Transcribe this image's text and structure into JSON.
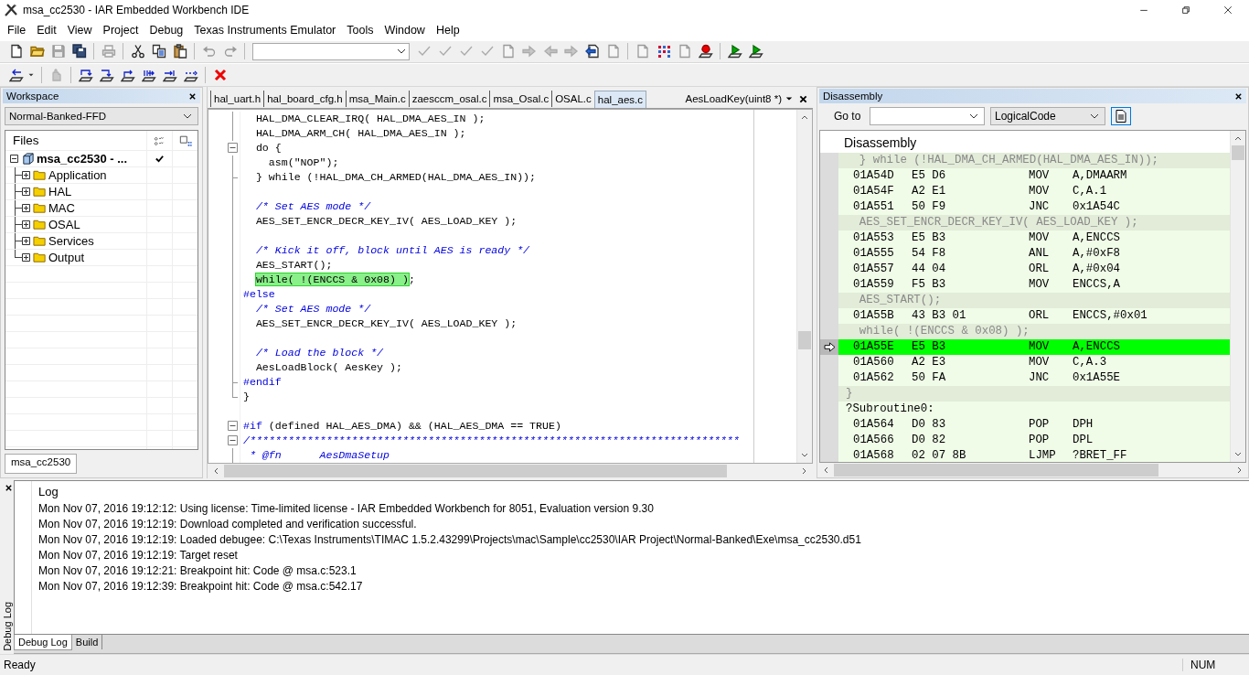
{
  "window": {
    "title": "msa_cc2530 - IAR Embedded Workbench IDE"
  },
  "menu": [
    "File",
    "Edit",
    "View",
    "Project",
    "Debug",
    "Texas Instruments Emulator",
    "Tools",
    "Window",
    "Help"
  ],
  "toolbar_1": [
    {
      "kind": "page",
      "disabled": false
    },
    {
      "kind": "folder",
      "disabled": false
    },
    {
      "kind": "floppy",
      "disabled": true
    },
    {
      "kind": "floppies",
      "disabled": false
    },
    {
      "kind": "separator"
    },
    {
      "kind": "printer",
      "disabled": true
    },
    {
      "kind": "separator"
    },
    {
      "kind": "scissors",
      "disabled": false
    },
    {
      "kind": "copy",
      "disabled": false
    },
    {
      "kind": "clipboard",
      "disabled": false
    },
    {
      "kind": "separator"
    },
    {
      "kind": "undo",
      "disabled": true
    },
    {
      "kind": "redo",
      "disabled": true
    },
    {
      "kind": "separator"
    },
    {
      "kind": "combo"
    },
    {
      "kind": "check",
      "disabled": true
    },
    {
      "kind": "check",
      "disabled": true
    },
    {
      "kind": "check",
      "disabled": true
    },
    {
      "kind": "check",
      "disabled": true
    },
    {
      "kind": "page",
      "disabled": true
    },
    {
      "kind": "arrow-right",
      "disabled": true
    },
    {
      "kind": "arrow-left",
      "disabled": true
    },
    {
      "kind": "arrow-right",
      "disabled": true
    },
    {
      "kind": "nav",
      "disabled": false
    },
    {
      "kind": "page",
      "disabled": true
    },
    {
      "kind": "separator"
    },
    {
      "kind": "page",
      "disabled": true
    },
    {
      "kind": "dots",
      "disabled": false
    },
    {
      "kind": "page",
      "disabled": true
    },
    {
      "kind": "dot",
      "disabled": false
    },
    {
      "kind": "separator"
    },
    {
      "kind": "play",
      "disabled": false
    },
    {
      "kind": "play",
      "disabled": false
    }
  ],
  "toolbar_2": [
    {
      "kind": "reset",
      "disabled": false
    },
    {
      "kind": "caret",
      "disabled": false
    },
    {
      "kind": "separator"
    },
    {
      "kind": "hand",
      "disabled": true
    },
    {
      "kind": "separator"
    },
    {
      "kind": "step-over",
      "disabled": false
    },
    {
      "kind": "step-into",
      "disabled": false
    },
    {
      "kind": "step-out",
      "disabled": false
    },
    {
      "kind": "next",
      "disabled": false
    },
    {
      "kind": "run-cursor",
      "disabled": false
    },
    {
      "kind": "go",
      "disabled": false
    },
    {
      "kind": "separator"
    },
    {
      "kind": "x",
      "disabled": false
    }
  ],
  "workspace": {
    "title": "Workspace",
    "configuration": "Normal-Banked-FFD",
    "files_header": "Files",
    "tree": {
      "label": "msa_cc2530 - ...",
      "expanded": true,
      "checked": true,
      "children": [
        {
          "label": "Application",
          "expanded": false
        },
        {
          "label": "HAL",
          "expanded": false
        },
        {
          "label": "MAC",
          "expanded": false
        },
        {
          "label": "OSAL",
          "expanded": false
        },
        {
          "label": "Services",
          "expanded": false
        },
        {
          "label": "Output",
          "expanded": false
        }
      ]
    },
    "tab": "msa_cc2530"
  },
  "editor": {
    "tabs": [
      {
        "label": "hal_uart.h",
        "selected": false
      },
      {
        "label": "hal_board_cfg.h",
        "selected": false
      },
      {
        "label": "msa_Main.c",
        "selected": false
      },
      {
        "label": "zaesccm_osal.c",
        "selected": false
      },
      {
        "label": "msa_Osal.c",
        "selected": false
      },
      {
        "label": "OSAL.c",
        "selected": false
      },
      {
        "label": "hal_aes.c",
        "selected": true
      }
    ],
    "function": "AesLoadKey(uint8 *)",
    "lines": [
      {
        "kind": "line",
        "segments": [
          {
            "kind": "code",
            "text": "  HAL_DMA_CLEAR_IRQ( HAL_DMA_AES_IN );"
          }
        ]
      },
      {
        "kind": "line",
        "segments": [
          {
            "kind": "code",
            "text": "  HAL_DMA_ARM_CH( HAL_DMA_AES_IN );"
          }
        ]
      },
      {
        "kind": "box",
        "segments": [
          {
            "kind": "code",
            "text": "  do {"
          }
        ]
      },
      {
        "kind": "line",
        "segments": [
          {
            "kind": "code",
            "text": "    asm(\"NOP\");"
          }
        ]
      },
      {
        "kind": "end",
        "segments": [
          {
            "kind": "code",
            "text": "  } while (!HAL_DMA_CH_ARMED(HAL_DMA_AES_IN));"
          }
        ]
      },
      {
        "kind": "line"
      },
      {
        "kind": "line",
        "segments": [
          {
            "kind": "comment",
            "text": "  /* Set AES mode */"
          }
        ]
      },
      {
        "kind": "line",
        "segments": [
          {
            "kind": "code",
            "text": "  AES_SET_ENCR_DECR_KEY_IV( AES_LOAD_KEY );"
          }
        ]
      },
      {
        "kind": "line"
      },
      {
        "kind": "line",
        "segments": [
          {
            "kind": "comment",
            "text": "  /* Kick it off, block until AES is ready */"
          }
        ]
      },
      {
        "kind": "line",
        "segments": [
          {
            "kind": "code",
            "text": "  AES_START();"
          }
        ]
      },
      {
        "kind": "line",
        "segments": [
          {
            "kind": "current",
            "text": "while( !(ENCCS & 0x08) )"
          },
          {
            "kind": "code",
            "text": ";"
          }
        ]
      },
      {
        "kind": "line",
        "segments": [
          {
            "kind": "preproc",
            "text": "#else"
          }
        ]
      },
      {
        "kind": "line",
        "segments": [
          {
            "kind": "comment",
            "text": "  /* Set AES mode */"
          }
        ]
      },
      {
        "kind": "line",
        "segments": [
          {
            "kind": "code",
            "text": "  AES_SET_ENCR_DECR_KEY_IV( AES_LOAD_KEY );"
          }
        ]
      },
      {
        "kind": "line"
      },
      {
        "kind": "line",
        "segments": [
          {
            "kind": "comment",
            "text": "  /* Load the block */"
          }
        ]
      },
      {
        "kind": "line",
        "segments": [
          {
            "kind": "code",
            "text": "  AesLoadBlock( AesKey );"
          }
        ]
      },
      {
        "kind": "end",
        "segments": [
          {
            "kind": "preproc",
            "text": "#endif"
          }
        ]
      },
      {
        "kind": "corner",
        "segments": [
          {
            "kind": "code",
            "text": "}"
          }
        ]
      },
      {
        "kind": "none"
      },
      {
        "kind": "box",
        "segments": [
          {
            "kind": "preproc",
            "text": "#if"
          },
          {
            "kind": "code",
            "text": " (defined HAL_AES_DMA) && (HAL_AES_DMA == TRUE)"
          }
        ]
      },
      {
        "kind": "box",
        "segments": [
          {
            "kind": "comment",
            "text": "/*****************************************************************************"
          }
        ]
      },
      {
        "kind": "line",
        "segments": [
          {
            "kind": "comment",
            "text": " * @fn      AesDmaSetup"
          }
        ]
      }
    ]
  },
  "disassembly": {
    "title": "Disassembly",
    "goto_label": "Go to",
    "view_mode": "LogicalCode",
    "header": "Disassembly",
    "rows": [
      {
        "kind": "source",
        "text": "  } while (!HAL_DMA_CH_ARMED(HAL_DMA_AES_IN));"
      },
      {
        "kind": "instr",
        "address": "01A54D",
        "bytes": "E5 D6",
        "mnemonic": "MOV",
        "operands": "A,DMAARM",
        "current": false
      },
      {
        "kind": "instr",
        "address": "01A54F",
        "bytes": "A2 E1",
        "mnemonic": "MOV",
        "operands": "C,A.1",
        "current": false
      },
      {
        "kind": "instr",
        "address": "01A551",
        "bytes": "50 F9",
        "mnemonic": "JNC",
        "operands": "0x1A54C",
        "current": false
      },
      {
        "kind": "source",
        "text": "  AES_SET_ENCR_DECR_KEY_IV( AES_LOAD_KEY );"
      },
      {
        "kind": "instr",
        "address": "01A553",
        "bytes": "E5 B3",
        "mnemonic": "MOV",
        "operands": "A,ENCCS",
        "current": false
      },
      {
        "kind": "instr",
        "address": "01A555",
        "bytes": "54 F8",
        "mnemonic": "ANL",
        "operands": "A,#0xF8",
        "current": false
      },
      {
        "kind": "instr",
        "address": "01A557",
        "bytes": "44 04",
        "mnemonic": "ORL",
        "operands": "A,#0x04",
        "current": false
      },
      {
        "kind": "instr",
        "address": "01A559",
        "bytes": "F5 B3",
        "mnemonic": "MOV",
        "operands": "ENCCS,A",
        "current": false
      },
      {
        "kind": "source",
        "text": "  AES_START();"
      },
      {
        "kind": "instr",
        "address": "01A55B",
        "bytes": "43 B3 01",
        "mnemonic": "ORL",
        "operands": "ENCCS,#0x01",
        "current": false
      },
      {
        "kind": "source",
        "text": "  while( !(ENCCS & 0x08) );"
      },
      {
        "kind": "instr",
        "address": "01A55E",
        "bytes": "E5 B3",
        "mnemonic": "MOV",
        "operands": "A,ENCCS",
        "current": true
      },
      {
        "kind": "instr",
        "address": "01A560",
        "bytes": "A2 E3",
        "mnemonic": "MOV",
        "operands": "C,A.3",
        "current": false
      },
      {
        "kind": "instr",
        "address": "01A562",
        "bytes": "50 FA",
        "mnemonic": "JNC",
        "operands": "0x1A55E",
        "current": false
      },
      {
        "kind": "source",
        "text": "}"
      },
      {
        "kind": "label",
        "text": "?Subroutine0:"
      },
      {
        "kind": "instr",
        "address": "01A564",
        "bytes": "D0 83",
        "mnemonic": "POP",
        "operands": "DPH",
        "current": false
      },
      {
        "kind": "instr",
        "address": "01A566",
        "bytes": "D0 82",
        "mnemonic": "POP",
        "operands": "DPL",
        "current": false
      },
      {
        "kind": "instr",
        "address": "01A568",
        "bytes": "02 07 8B",
        "mnemonic": "LJMP",
        "operands": "?BRET_FF",
        "current": false
      }
    ]
  },
  "log": {
    "side_label": "Debug Log",
    "header": "Log",
    "lines": [
      "Mon Nov 07, 2016 19:12:12: Using license: Time-limited license - IAR Embedded Workbench for 8051, Evaluation version 9.30",
      "Mon Nov 07, 2016 19:12:19: Download completed and verification successful.",
      "Mon Nov 07, 2016 19:12:19: Loaded debugee: C:\\Texas Instruments\\TIMAC 1.5.2.43299\\Projects\\mac\\Sample\\cc2530\\IAR Project\\Normal-Banked\\Exe\\msa_cc2530.d51",
      "Mon Nov 07, 2016 19:12:19: Target reset",
      "Mon Nov 07, 2016 19:12:21: Breakpoint hit: Code @ msa.c:523.1",
      "Mon Nov 07, 2016 19:12:39: Breakpoint hit: Code @ msa.c:542.17"
    ],
    "tabs": [
      {
        "label": "Debug Log",
        "selected": true
      },
      {
        "label": "Build",
        "selected": false
      }
    ]
  },
  "status_bar": {
    "message": "Ready",
    "indicators": [
      "NUM"
    ]
  }
}
